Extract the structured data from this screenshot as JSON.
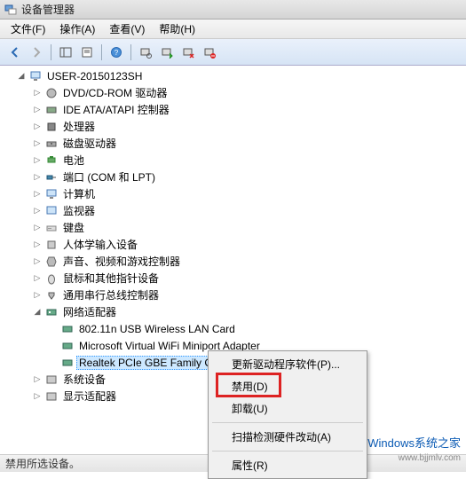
{
  "window": {
    "title": "设备管理器"
  },
  "menubar": {
    "file": "文件(F)",
    "action": "操作(A)",
    "view": "查看(V)",
    "help": "帮助(H)"
  },
  "tree": {
    "root": "USER-20150123SH",
    "categories": [
      "DVD/CD-ROM 驱动器",
      "IDE ATA/ATAPI 控制器",
      "处理器",
      "磁盘驱动器",
      "电池",
      "端口 (COM 和 LPT)",
      "计算机",
      "监视器",
      "键盘",
      "人体学输入设备",
      "声音、视频和游戏控制器",
      "鼠标和其他指针设备",
      "通用串行总线控制器"
    ],
    "network": {
      "label": "网络适配器",
      "children": [
        "802.11n USB Wireless LAN Card",
        "Microsoft Virtual WiFi Miniport Adapter",
        "Realtek PCIe GBE Family Controller"
      ]
    },
    "after": [
      "系统设备",
      "显示适配器"
    ]
  },
  "context_menu": {
    "update": "更新驱动程序软件(P)...",
    "disable": "禁用(D)",
    "uninstall": "卸载(U)",
    "scan": "扫描检测硬件改动(A)",
    "properties": "属性(R)"
  },
  "statusbar": {
    "text": "禁用所选设备。"
  },
  "watermark": {
    "text": "Windows系统之家",
    "sub": "www.bjjmlv.com"
  }
}
